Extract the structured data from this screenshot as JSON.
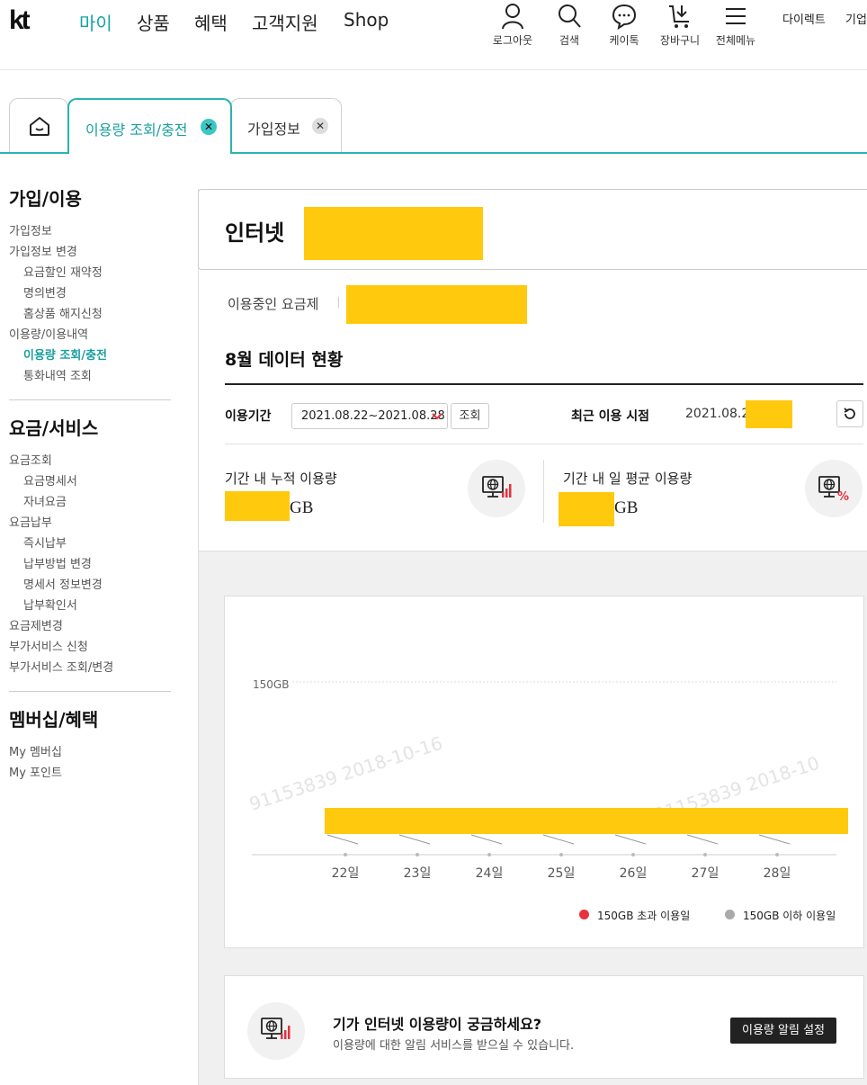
{
  "header": {
    "logo": "kt",
    "nav": [
      "마이",
      "상품",
      "혜택",
      "고객지원",
      "Shop"
    ],
    "utils": [
      {
        "icon": "person-icon",
        "label": "로그아웃"
      },
      {
        "icon": "search-icon",
        "label": "검색"
      },
      {
        "icon": "chat-icon",
        "label": "케이톡"
      },
      {
        "icon": "cart-icon",
        "label": "장바구니"
      },
      {
        "icon": "menu-icon",
        "label": "전체메뉴"
      }
    ],
    "links": [
      "다이렉트",
      "기업"
    ]
  },
  "tabs": {
    "home_icon": "home-icon",
    "items": [
      {
        "label": "이용량 조회/충전",
        "active": true
      },
      {
        "label": "가입정보",
        "active": false
      }
    ],
    "close": "✕"
  },
  "sidebar": {
    "sections": [
      {
        "title": "가입/이용",
        "items": [
          {
            "label": "가입정보",
            "sub": false
          },
          {
            "label": "가입정보 변경",
            "sub": false
          },
          {
            "label": "요금할인 재약정",
            "sub": true
          },
          {
            "label": "명의변경",
            "sub": true
          },
          {
            "label": "홈상품 해지신청",
            "sub": true
          },
          {
            "label": "이용량/이용내역",
            "sub": false
          },
          {
            "label": "이용량 조회/충전",
            "sub": true,
            "active": true
          },
          {
            "label": "통화내역 조회",
            "sub": true
          }
        ]
      },
      {
        "title": "요금/서비스",
        "items": [
          {
            "label": "요금조회",
            "sub": false
          },
          {
            "label": "요금명세서",
            "sub": true
          },
          {
            "label": "자녀요금",
            "sub": true
          },
          {
            "label": "요금납부",
            "sub": false
          },
          {
            "label": "즉시납부",
            "sub": true
          },
          {
            "label": "납부방법 변경",
            "sub": true
          },
          {
            "label": "명세서 정보변경",
            "sub": true
          },
          {
            "label": "납부확인서",
            "sub": true
          },
          {
            "label": "요금제변경",
            "sub": false
          },
          {
            "label": "부가서비스 신청",
            "sub": false
          },
          {
            "label": "부가서비스 조회/변경",
            "sub": false
          }
        ]
      },
      {
        "title": "멤버십/혜택",
        "items": [
          {
            "label": "My 멤버십",
            "sub": false
          },
          {
            "label": "My 포인트",
            "sub": false
          }
        ]
      }
    ]
  },
  "main": {
    "product_title": "인터넷",
    "plan_label": "이용중인 요금제",
    "section_title": "8월 데이터 현황",
    "period_label": "이용기간",
    "period_value": "2021.08.22~2021.08.28",
    "query_button": "조회",
    "recent_label": "최근 이용 시점",
    "recent_value": "2021.08.28",
    "cum_label": "기간 내 누적 이용량",
    "avg_label": "기간 내 일 평균 이용량",
    "unit": "GB"
  },
  "chart_data": {
    "type": "line",
    "categories": [
      "22일",
      "23일",
      "24일",
      "25일",
      "26일",
      "27일",
      "28일"
    ],
    "threshold_label": "150GB",
    "legend": [
      {
        "label": "150GB 초과 이용일",
        "color": "#e8323c"
      },
      {
        "label": "150GB 이하 이용일",
        "color": "#aaaaaa"
      }
    ],
    "watermark": [
      "91153839 2018-10-16",
      "91153839 2018-10"
    ]
  },
  "notice": {
    "title": "기가 인터넷 이용량이 궁금하세요?",
    "desc": "이용량에 대한 알림 서비스를 받으실 수 있습니다.",
    "button": "이용량 알림 설정"
  },
  "colors": {
    "accent": "#15a3a3",
    "mask": "#ffc90d",
    "danger": "#e8323c"
  }
}
